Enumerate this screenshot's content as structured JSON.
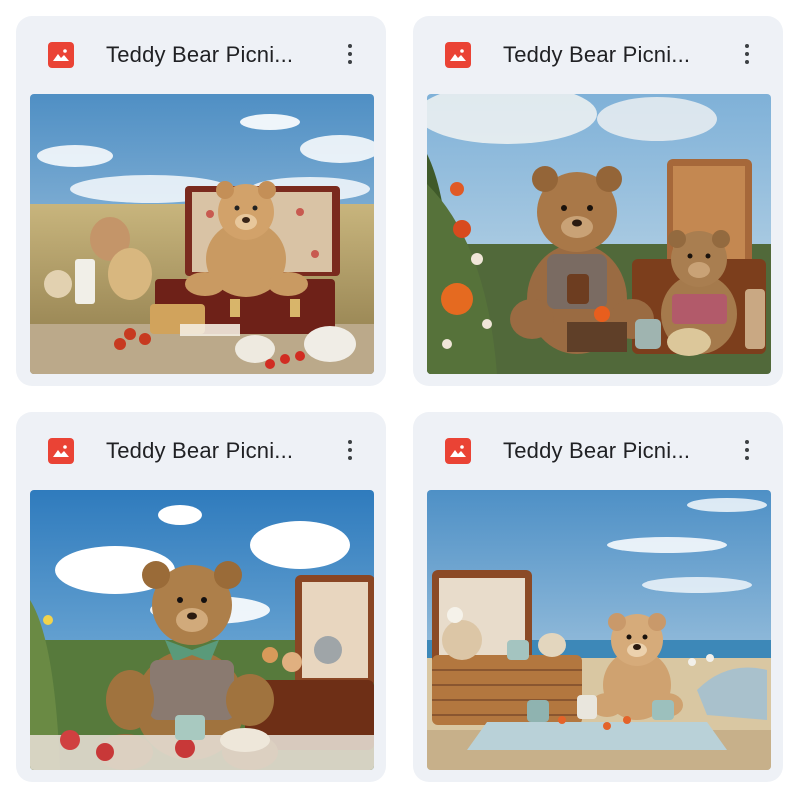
{
  "files": [
    {
      "title": "Teddy Bear Picni...",
      "type_icon": "image-icon",
      "menu_icon": "more-vert-icon"
    },
    {
      "title": "Teddy Bear Picni...",
      "type_icon": "image-icon",
      "menu_icon": "more-vert-icon"
    },
    {
      "title": "Teddy Bear Picni...",
      "type_icon": "image-icon",
      "menu_icon": "more-vert-icon"
    },
    {
      "title": "Teddy Bear Picni...",
      "type_icon": "image-icon",
      "menu_icon": "more-vert-icon"
    }
  ],
  "colors": {
    "card_bg": "#eef1f6",
    "icon_red": "#ea4335",
    "title_text": "#202124"
  }
}
